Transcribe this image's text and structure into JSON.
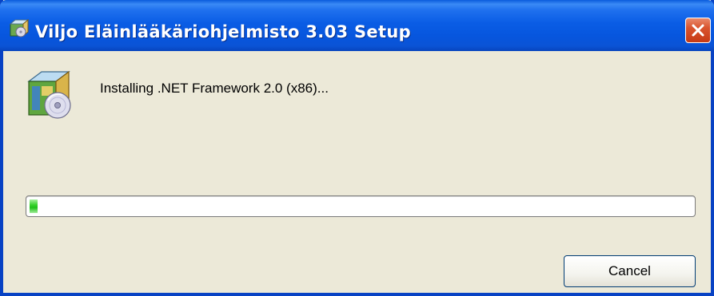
{
  "window": {
    "title": "Viljo Eläinlääkäriohjelmisto 3.03 Setup",
    "title_icon": "installer-box-icon",
    "close_icon": "close-icon"
  },
  "content": {
    "icon": "installer-box-cd-icon",
    "status": "Installing .NET Framework 2.0 (x86)..."
  },
  "progress": {
    "percent": 2,
    "fill_color": "#37d22d"
  },
  "buttons": {
    "cancel": "Cancel"
  },
  "colors": {
    "titlebar": "#0a5de5",
    "window_bg": "#ece9d8",
    "close_button": "#d9542e"
  }
}
